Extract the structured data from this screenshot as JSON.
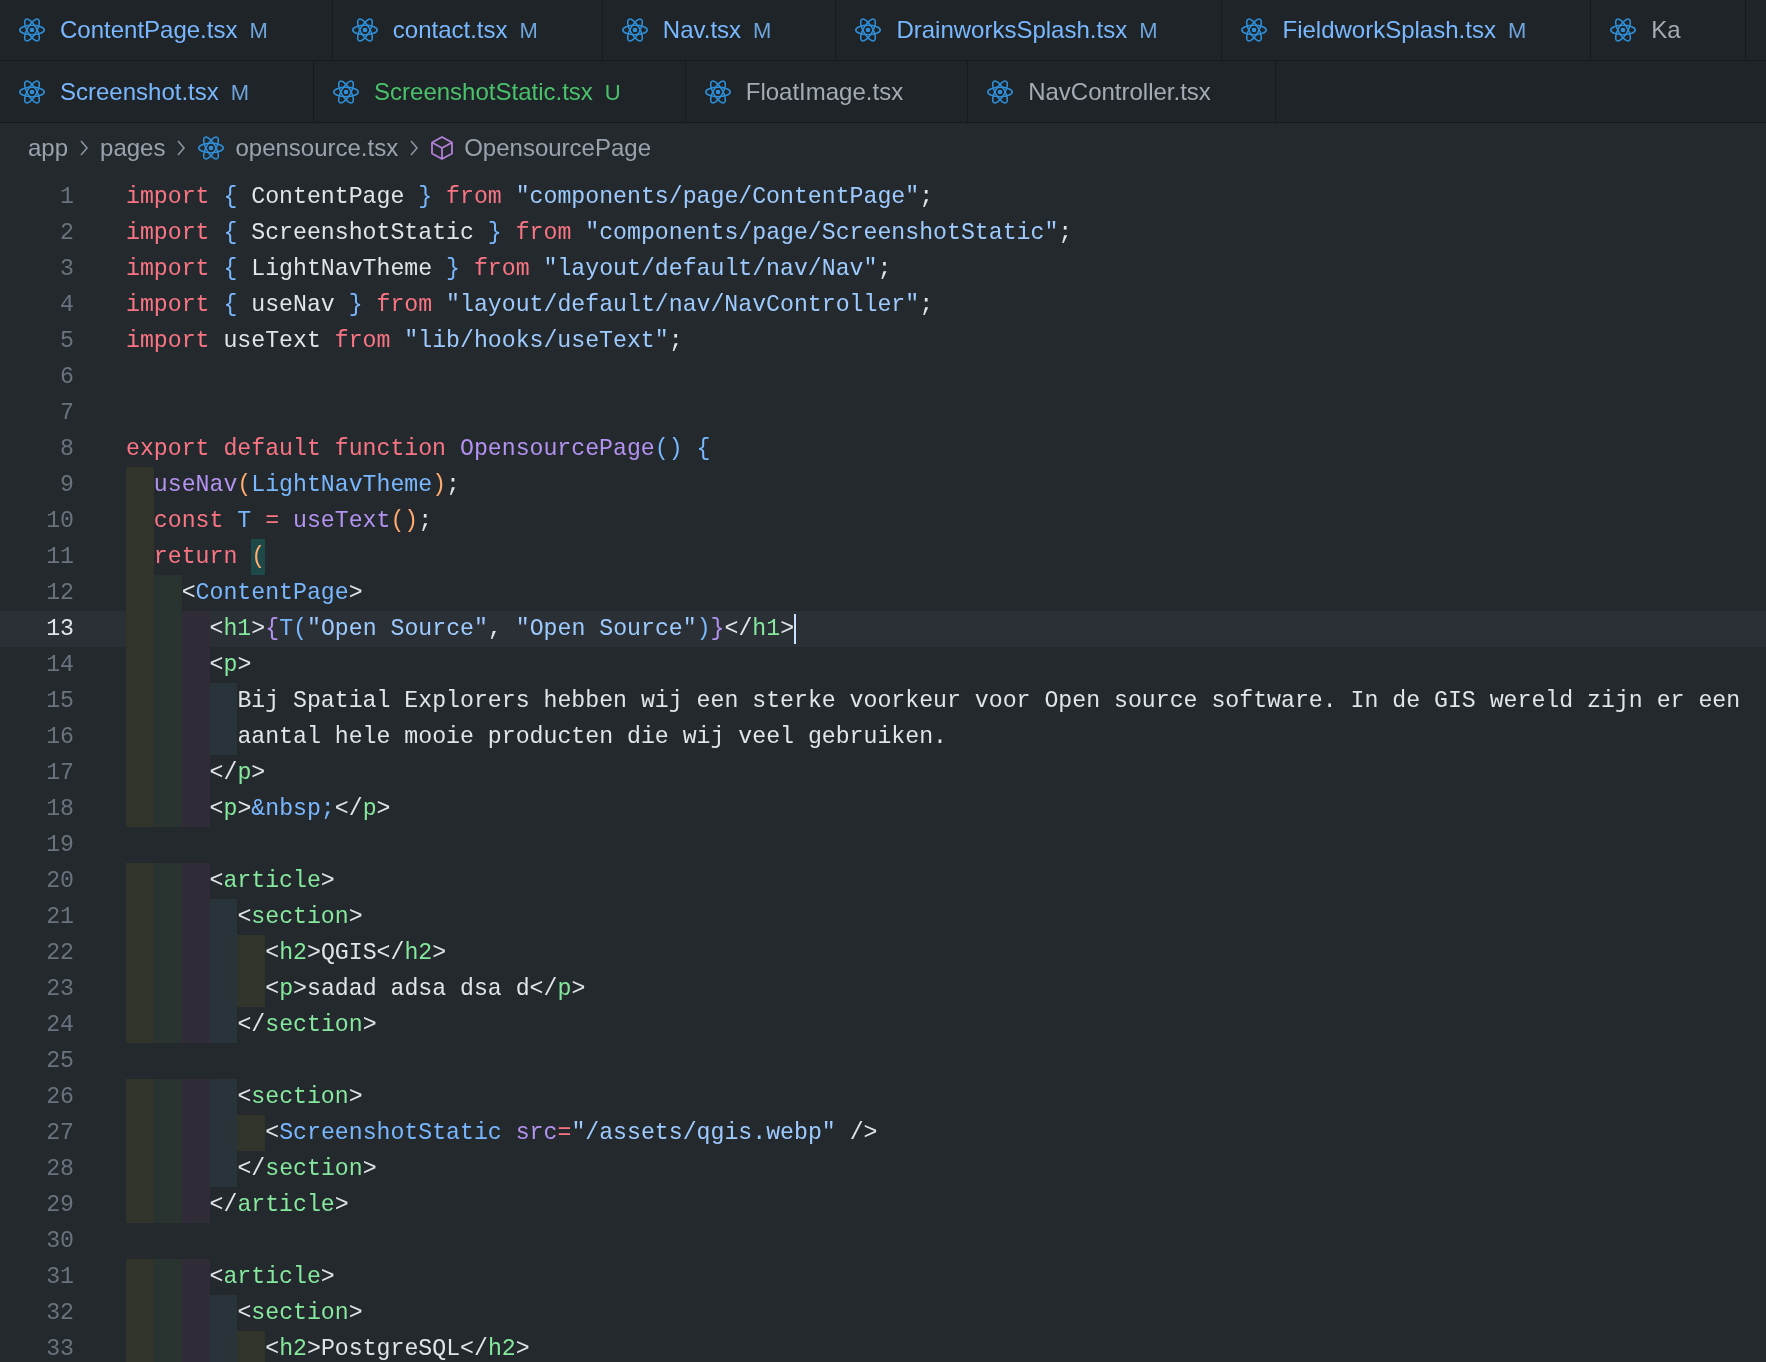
{
  "tab_rows": [
    [
      {
        "label": "ContentPage.tsx",
        "status": "M"
      },
      {
        "label": "contact.tsx",
        "status": "M"
      },
      {
        "label": "Nav.tsx",
        "status": "M"
      },
      {
        "label": "DrainworksSplash.tsx",
        "status": "M"
      },
      {
        "label": "FieldworkSplash.tsx",
        "status": "M"
      },
      {
        "label": "Ka"
      }
    ],
    [
      {
        "label": "Screenshot.tsx",
        "status": "M"
      },
      {
        "label": "ScreenshotStatic.tsx",
        "status": "U"
      },
      {
        "label": "FloatImage.tsx"
      },
      {
        "label": "NavController.tsx"
      }
    ]
  ],
  "breadcrumbs": [
    {
      "kind": "folder",
      "label": "app"
    },
    {
      "kind": "folder",
      "label": "pages"
    },
    {
      "kind": "file",
      "label": "opensource.tsx"
    },
    {
      "kind": "symbol",
      "label": "OpensourcePage"
    }
  ],
  "code_lines": [
    {
      "number": "1",
      "tokens": [
        {
          "kind": "kw",
          "text": "import "
        },
        {
          "kind": "blue",
          "text": "{ "
        },
        {
          "kind": "txt",
          "text": "ContentPage "
        },
        {
          "kind": "blue",
          "text": "} "
        },
        {
          "kind": "kw",
          "text": "from "
        },
        {
          "kind": "str",
          "text": "\"components/page/ContentPage\""
        },
        {
          "kind": "txt",
          "text": ";"
        }
      ]
    },
    {
      "number": "2",
      "tokens": [
        {
          "kind": "kw",
          "text": "import "
        },
        {
          "kind": "blue",
          "text": "{ "
        },
        {
          "kind": "txt",
          "text": "ScreenshotStatic "
        },
        {
          "kind": "blue",
          "text": "} "
        },
        {
          "kind": "kw",
          "text": "from "
        },
        {
          "kind": "str",
          "text": "\"components/page/ScreenshotStatic\""
        },
        {
          "kind": "txt",
          "text": ";"
        }
      ]
    },
    {
      "number": "3",
      "tokens": [
        {
          "kind": "kw",
          "text": "import "
        },
        {
          "kind": "blue",
          "text": "{ "
        },
        {
          "kind": "txt",
          "text": "LightNavTheme "
        },
        {
          "kind": "blue",
          "text": "} "
        },
        {
          "kind": "kw",
          "text": "from "
        },
        {
          "kind": "str",
          "text": "\"layout/default/nav/Nav\""
        },
        {
          "kind": "txt",
          "text": ";"
        }
      ]
    },
    {
      "number": "4",
      "tokens": [
        {
          "kind": "kw",
          "text": "import "
        },
        {
          "kind": "blue",
          "text": "{ "
        },
        {
          "kind": "txt",
          "text": "useNav "
        },
        {
          "kind": "blue",
          "text": "} "
        },
        {
          "kind": "kw",
          "text": "from "
        },
        {
          "kind": "str",
          "text": "\"layout/default/nav/NavController\""
        },
        {
          "kind": "txt",
          "text": ";"
        }
      ]
    },
    {
      "number": "5",
      "tokens": [
        {
          "kind": "kw",
          "text": "import "
        },
        {
          "kind": "txt",
          "text": "useText "
        },
        {
          "kind": "kw",
          "text": "from "
        },
        {
          "kind": "str",
          "text": "\"lib/hooks/useText\""
        },
        {
          "kind": "txt",
          "text": ";"
        }
      ]
    },
    {
      "number": "6"
    },
    {
      "number": "7"
    },
    {
      "number": "8",
      "tokens": [
        {
          "kind": "kw",
          "text": "export default function "
        },
        {
          "kind": "fn",
          "text": "OpensourcePage"
        },
        {
          "kind": "blue",
          "text": "() {"
        }
      ]
    },
    {
      "number": "9",
      "tokens": [
        {
          "kind": "fn",
          "text": "  useNav"
        },
        {
          "kind": "orange",
          "text": "("
        },
        {
          "kind": "blue",
          "text": "LightNavTheme"
        },
        {
          "kind": "orange",
          "text": ")"
        },
        {
          "kind": "txt",
          "text": ";"
        }
      ]
    },
    {
      "number": "10",
      "tokens": [
        {
          "kind": "kw",
          "text": "  const "
        },
        {
          "kind": "blue",
          "text": "T "
        },
        {
          "kind": "kw",
          "text": "= "
        },
        {
          "kind": "fn",
          "text": "useText"
        },
        {
          "kind": "orange",
          "text": "()"
        },
        {
          "kind": "txt",
          "text": ";"
        }
      ]
    },
    {
      "number": "11",
      "tokens": [
        {
          "kind": "kw",
          "text": "  return "
        },
        {
          "kind": "match",
          "text": "("
        }
      ]
    },
    {
      "number": "12",
      "tokens": [
        {
          "kind": "txt",
          "text": "    <"
        },
        {
          "kind": "comp",
          "text": "ContentPage"
        },
        {
          "kind": "txt",
          "text": ">"
        }
      ]
    },
    {
      "number": "13",
      "current": true,
      "tokens": [
        {
          "kind": "txt",
          "text": "      <"
        },
        {
          "kind": "tag",
          "text": "h1"
        },
        {
          "kind": "txt",
          "text": ">"
        },
        {
          "kind": "purple",
          "text": "{"
        },
        {
          "kind": "blue",
          "text": "T("
        },
        {
          "kind": "str",
          "text": "\"Open Source\""
        },
        {
          "kind": "txt",
          "text": ", "
        },
        {
          "kind": "str",
          "text": "\"Open Source\""
        },
        {
          "kind": "blue",
          "text": ")"
        },
        {
          "kind": "purple",
          "text": "}"
        },
        {
          "kind": "txt",
          "text": "</"
        },
        {
          "kind": "tag",
          "text": "h1"
        },
        {
          "kind": "txt",
          "text": ">"
        }
      ]
    },
    {
      "number": "14",
      "tokens": [
        {
          "kind": "txt",
          "text": "      <"
        },
        {
          "kind": "tag",
          "text": "p"
        },
        {
          "kind": "txt",
          "text": ">"
        }
      ]
    },
    {
      "number": "15",
      "tokens": [
        {
          "kind": "txt",
          "text": "        Bij Spatial Explorers hebben wij een sterke voorkeur voor Open source software. In de GIS wereld zijn er een"
        }
      ]
    },
    {
      "number": "16",
      "tokens": [
        {
          "kind": "txt",
          "text": "        aantal hele mooie producten die wij veel gebruiken."
        }
      ]
    },
    {
      "number": "17",
      "tokens": [
        {
          "kind": "txt",
          "text": "      </"
        },
        {
          "kind": "tag",
          "text": "p"
        },
        {
          "kind": "txt",
          "text": ">"
        }
      ]
    },
    {
      "number": "18",
      "tokens": [
        {
          "kind": "txt",
          "text": "      <"
        },
        {
          "kind": "tag",
          "text": "p"
        },
        {
          "kind": "txt",
          "text": ">"
        },
        {
          "kind": "blue",
          "text": "&nbsp;"
        },
        {
          "kind": "txt",
          "text": "</"
        },
        {
          "kind": "tag",
          "text": "p"
        },
        {
          "kind": "txt",
          "text": ">"
        }
      ]
    },
    {
      "number": "19"
    },
    {
      "number": "20",
      "tokens": [
        {
          "kind": "txt",
          "text": "      <"
        },
        {
          "kind": "tag",
          "text": "article"
        },
        {
          "kind": "txt",
          "text": ">"
        }
      ]
    },
    {
      "number": "21",
      "tokens": [
        {
          "kind": "txt",
          "text": "        <"
        },
        {
          "kind": "tag",
          "text": "section"
        },
        {
          "kind": "txt",
          "text": ">"
        }
      ]
    },
    {
      "number": "22",
      "tokens": [
        {
          "kind": "txt",
          "text": "          <"
        },
        {
          "kind": "tag",
          "text": "h2"
        },
        {
          "kind": "txt",
          "text": ">QGIS</"
        },
        {
          "kind": "tag",
          "text": "h2"
        },
        {
          "kind": "txt",
          "text": ">"
        }
      ]
    },
    {
      "number": "23",
      "tokens": [
        {
          "kind": "txt",
          "text": "          <"
        },
        {
          "kind": "tag",
          "text": "p"
        },
        {
          "kind": "txt",
          "text": ">sadad adsa dsa d</"
        },
        {
          "kind": "tag",
          "text": "p"
        },
        {
          "kind": "txt",
          "text": ">"
        }
      ]
    },
    {
      "number": "24",
      "tokens": [
        {
          "kind": "txt",
          "text": "        </"
        },
        {
          "kind": "tag",
          "text": "section"
        },
        {
          "kind": "txt",
          "text": ">"
        }
      ]
    },
    {
      "number": "25"
    },
    {
      "number": "26",
      "tokens": [
        {
          "kind": "txt",
          "text": "        <"
        },
        {
          "kind": "tag",
          "text": "section"
        },
        {
          "kind": "txt",
          "text": ">"
        }
      ]
    },
    {
      "number": "27",
      "tokens": [
        {
          "kind": "txt",
          "text": "          <"
        },
        {
          "kind": "comp",
          "text": "ScreenshotStatic "
        },
        {
          "kind": "purple",
          "text": "src"
        },
        {
          "kind": "kw",
          "text": "="
        },
        {
          "kind": "str",
          "text": "\"/assets/qgis.webp\""
        },
        {
          "kind": "txt",
          "text": " />"
        }
      ]
    },
    {
      "number": "28",
      "tokens": [
        {
          "kind": "txt",
          "text": "        </"
        },
        {
          "kind": "tag",
          "text": "section"
        },
        {
          "kind": "txt",
          "text": ">"
        }
      ]
    },
    {
      "number": "29",
      "tokens": [
        {
          "kind": "txt",
          "text": "      </"
        },
        {
          "kind": "tag",
          "text": "article"
        },
        {
          "kind": "txt",
          "text": ">"
        }
      ]
    },
    {
      "number": "30"
    },
    {
      "number": "31",
      "tokens": [
        {
          "kind": "txt",
          "text": "      <"
        },
        {
          "kind": "tag",
          "text": "article"
        },
        {
          "kind": "txt",
          "text": ">"
        }
      ]
    },
    {
      "number": "32",
      "tokens": [
        {
          "kind": "txt",
          "text": "        <"
        },
        {
          "kind": "tag",
          "text": "section"
        },
        {
          "kind": "txt",
          "text": ">"
        }
      ]
    },
    {
      "number": "33",
      "tokens": [
        {
          "kind": "txt",
          "text": "          <"
        },
        {
          "kind": "tag",
          "text": "h2"
        },
        {
          "kind": "txt",
          "text": ">PostgreSQL</"
        },
        {
          "kind": "tag",
          "text": "h2"
        },
        {
          "kind": "txt",
          "text": ">"
        }
      ]
    }
  ]
}
